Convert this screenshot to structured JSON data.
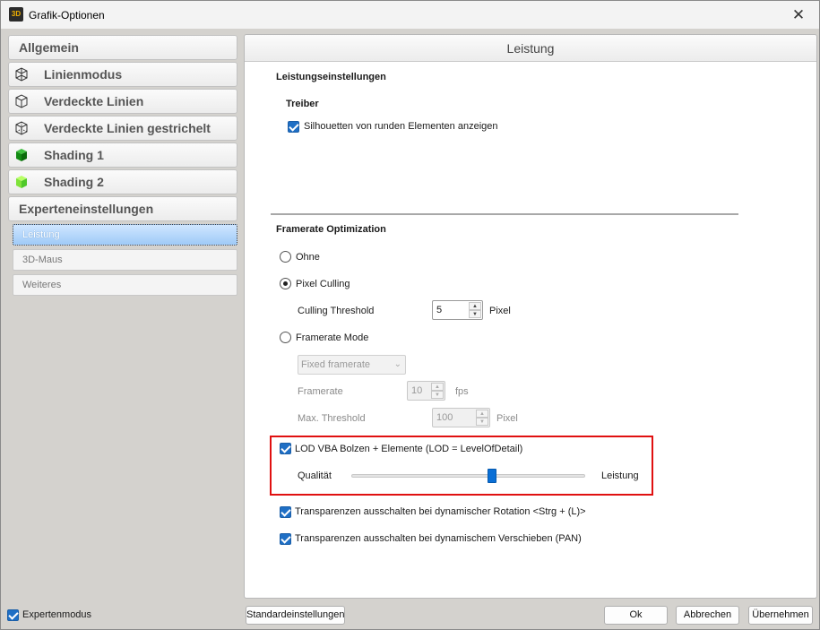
{
  "window": {
    "title": "Grafik-Optionen",
    "app_icon_text": "3D"
  },
  "nav": {
    "allgemein": "Allgemein",
    "linienmodus": "Linienmodus",
    "verdeckte_linien": "Verdeckte Linien",
    "verdeckte_linien_gestrichelt": "Verdeckte Linien gestrichelt",
    "shading1": "Shading 1",
    "shading2": "Shading 2",
    "experteneinstellungen": "Experteneinstellungen",
    "leistung": "Leistung",
    "maus3d": "3D-Maus",
    "weiteres": "Weiteres"
  },
  "panel": {
    "header": "Leistung",
    "section_title": "Leistungseinstellungen",
    "driver_title": "Treiber",
    "silhouette_label": "Silhouetten von runden Elementen anzeigen",
    "framerate_title": "Framerate Optimization",
    "radio_ohne": "Ohne",
    "radio_pixel_culling": "Pixel Culling",
    "culling_threshold_label": "Culling Threshold",
    "culling_threshold_value": "5",
    "pixel_unit": "Pixel",
    "radio_framerate_mode": "Framerate Mode",
    "framerate_mode_select": "Fixed framerate",
    "framerate_label": "Framerate",
    "framerate_value": "10",
    "fps_unit": "fps",
    "max_threshold_label": "Max. Threshold",
    "max_threshold_value": "100",
    "max_threshold_unit": "Pixel",
    "lod_label": "LOD VBA Bolzen + Elemente (LOD = LevelOfDetail)",
    "quality_label": "Qualität",
    "performance_label": "Leistung",
    "lod_slider_value": 0.6,
    "transp_rotation_label": "Transparenzen ausschalten bei dynamischer Rotation <Strg + (L)>",
    "transp_pan_label": "Transparenzen ausschalten bei dynamischem Verschieben (PAN)"
  },
  "footer": {
    "expert_mode_label": "Expertenmodus",
    "defaults_button": "Standardeinstellungen",
    "ok_button": "Ok",
    "cancel_button": "Abbrechen",
    "apply_button": "Übernehmen"
  },
  "colors": {
    "accent": "#1f6fc5",
    "highlight_border": "#e01010",
    "slider_thumb": "#0a6fd6"
  }
}
